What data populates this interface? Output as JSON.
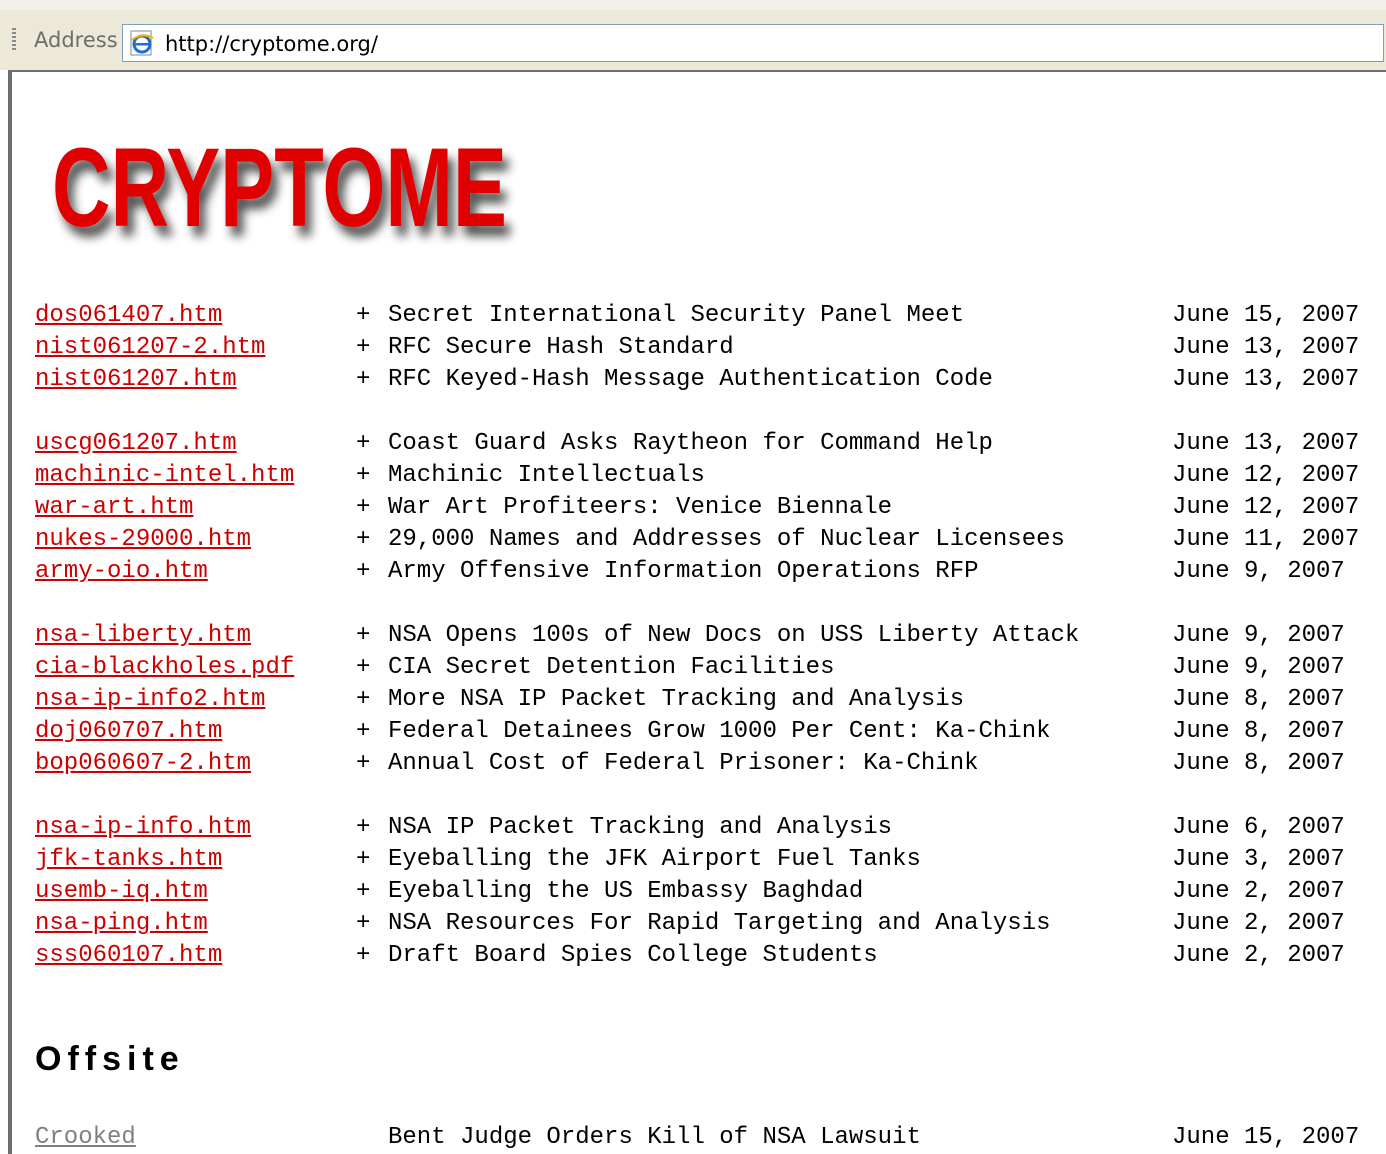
{
  "browser": {
    "address_label": "Address",
    "url": "http://cryptome.org/"
  },
  "site": {
    "logo_text": "CRYPTOME",
    "brand_color": "#e00000",
    "link_color": "#cc0000",
    "visited_link_color": "#808080"
  },
  "groups": [
    {
      "rows": [
        {
          "file": "dos061407.htm",
          "plus": "+",
          "title": "Secret International Security Panel Meet",
          "date": "June 15, 2007"
        },
        {
          "file": "nist061207-2.htm",
          "plus": "+",
          "title": "RFC Secure Hash Standard",
          "date": "June 13, 2007"
        },
        {
          "file": "nist061207.htm",
          "plus": "+",
          "title": "RFC Keyed-Hash Message Authentication Code",
          "date": "June 13, 2007"
        }
      ]
    },
    {
      "rows": [
        {
          "file": "uscg061207.htm",
          "plus": "+",
          "title": "Coast Guard Asks Raytheon for Command Help",
          "date": "June 13, 2007"
        },
        {
          "file": "machinic-intel.htm",
          "plus": "+",
          "title": "Machinic Intellectuals",
          "date": "June 12, 2007"
        },
        {
          "file": "war-art.htm",
          "plus": "+",
          "title": "War Art Profiteers: Venice Biennale",
          "date": "June 12, 2007"
        },
        {
          "file": "nukes-29000.htm",
          "plus": "+",
          "title": "29,000 Names and Addresses of Nuclear Licensees",
          "date": "June 11, 2007"
        },
        {
          "file": "army-oio.htm",
          "plus": "+",
          "title": "Army Offensive Information Operations RFP",
          "date": "June 9, 2007"
        }
      ]
    },
    {
      "rows": [
        {
          "file": "nsa-liberty.htm",
          "plus": "+",
          "title": "NSA Opens 100s of New Docs on USS Liberty Attack",
          "date": "June 9, 2007"
        },
        {
          "file": "cia-blackholes.pdf",
          "plus": "+",
          "title": "CIA Secret Detention Facilities",
          "date": "June 9, 2007"
        },
        {
          "file": "nsa-ip-info2.htm",
          "plus": "+",
          "title": "More NSA IP Packet Tracking and Analysis",
          "date": "June 8, 2007"
        },
        {
          "file": "doj060707.htm",
          "plus": "+",
          "title": "Federal Detainees Grow 1000 Per Cent: Ka-Chink",
          "date": "June 8, 2007"
        },
        {
          "file": "bop060607-2.htm",
          "plus": "+",
          "title": "Annual Cost of Federal Prisoner: Ka-Chink",
          "date": "June 8, 2007"
        }
      ]
    },
    {
      "rows": [
        {
          "file": "nsa-ip-info.htm",
          "plus": "+",
          "title": "NSA IP Packet Tracking and Analysis",
          "date": "June 6, 2007"
        },
        {
          "file": "jfk-tanks.htm",
          "plus": "+",
          "title": "Eyeballing the JFK Airport Fuel Tanks",
          "date": "June 3, 2007"
        },
        {
          "file": "usemb-iq.htm",
          "plus": "+",
          "title": "Eyeballing the US Embassy Baghdad",
          "date": "June 2, 2007"
        },
        {
          "file": "nsa-ping.htm",
          "plus": "+",
          "title": "NSA Resources For Rapid Targeting and Analysis",
          "date": "June 2, 2007"
        },
        {
          "file": "sss060107.htm",
          "plus": "+",
          "title": "Draft Board Spies College Students",
          "date": "June 2, 2007"
        }
      ]
    }
  ],
  "offsite": {
    "heading": "Offsite",
    "rows": [
      {
        "file": "Crooked",
        "title": "Bent Judge Orders Kill of NSA Lawsuit",
        "date": "June 15, 2007",
        "visited": true
      }
    ]
  }
}
